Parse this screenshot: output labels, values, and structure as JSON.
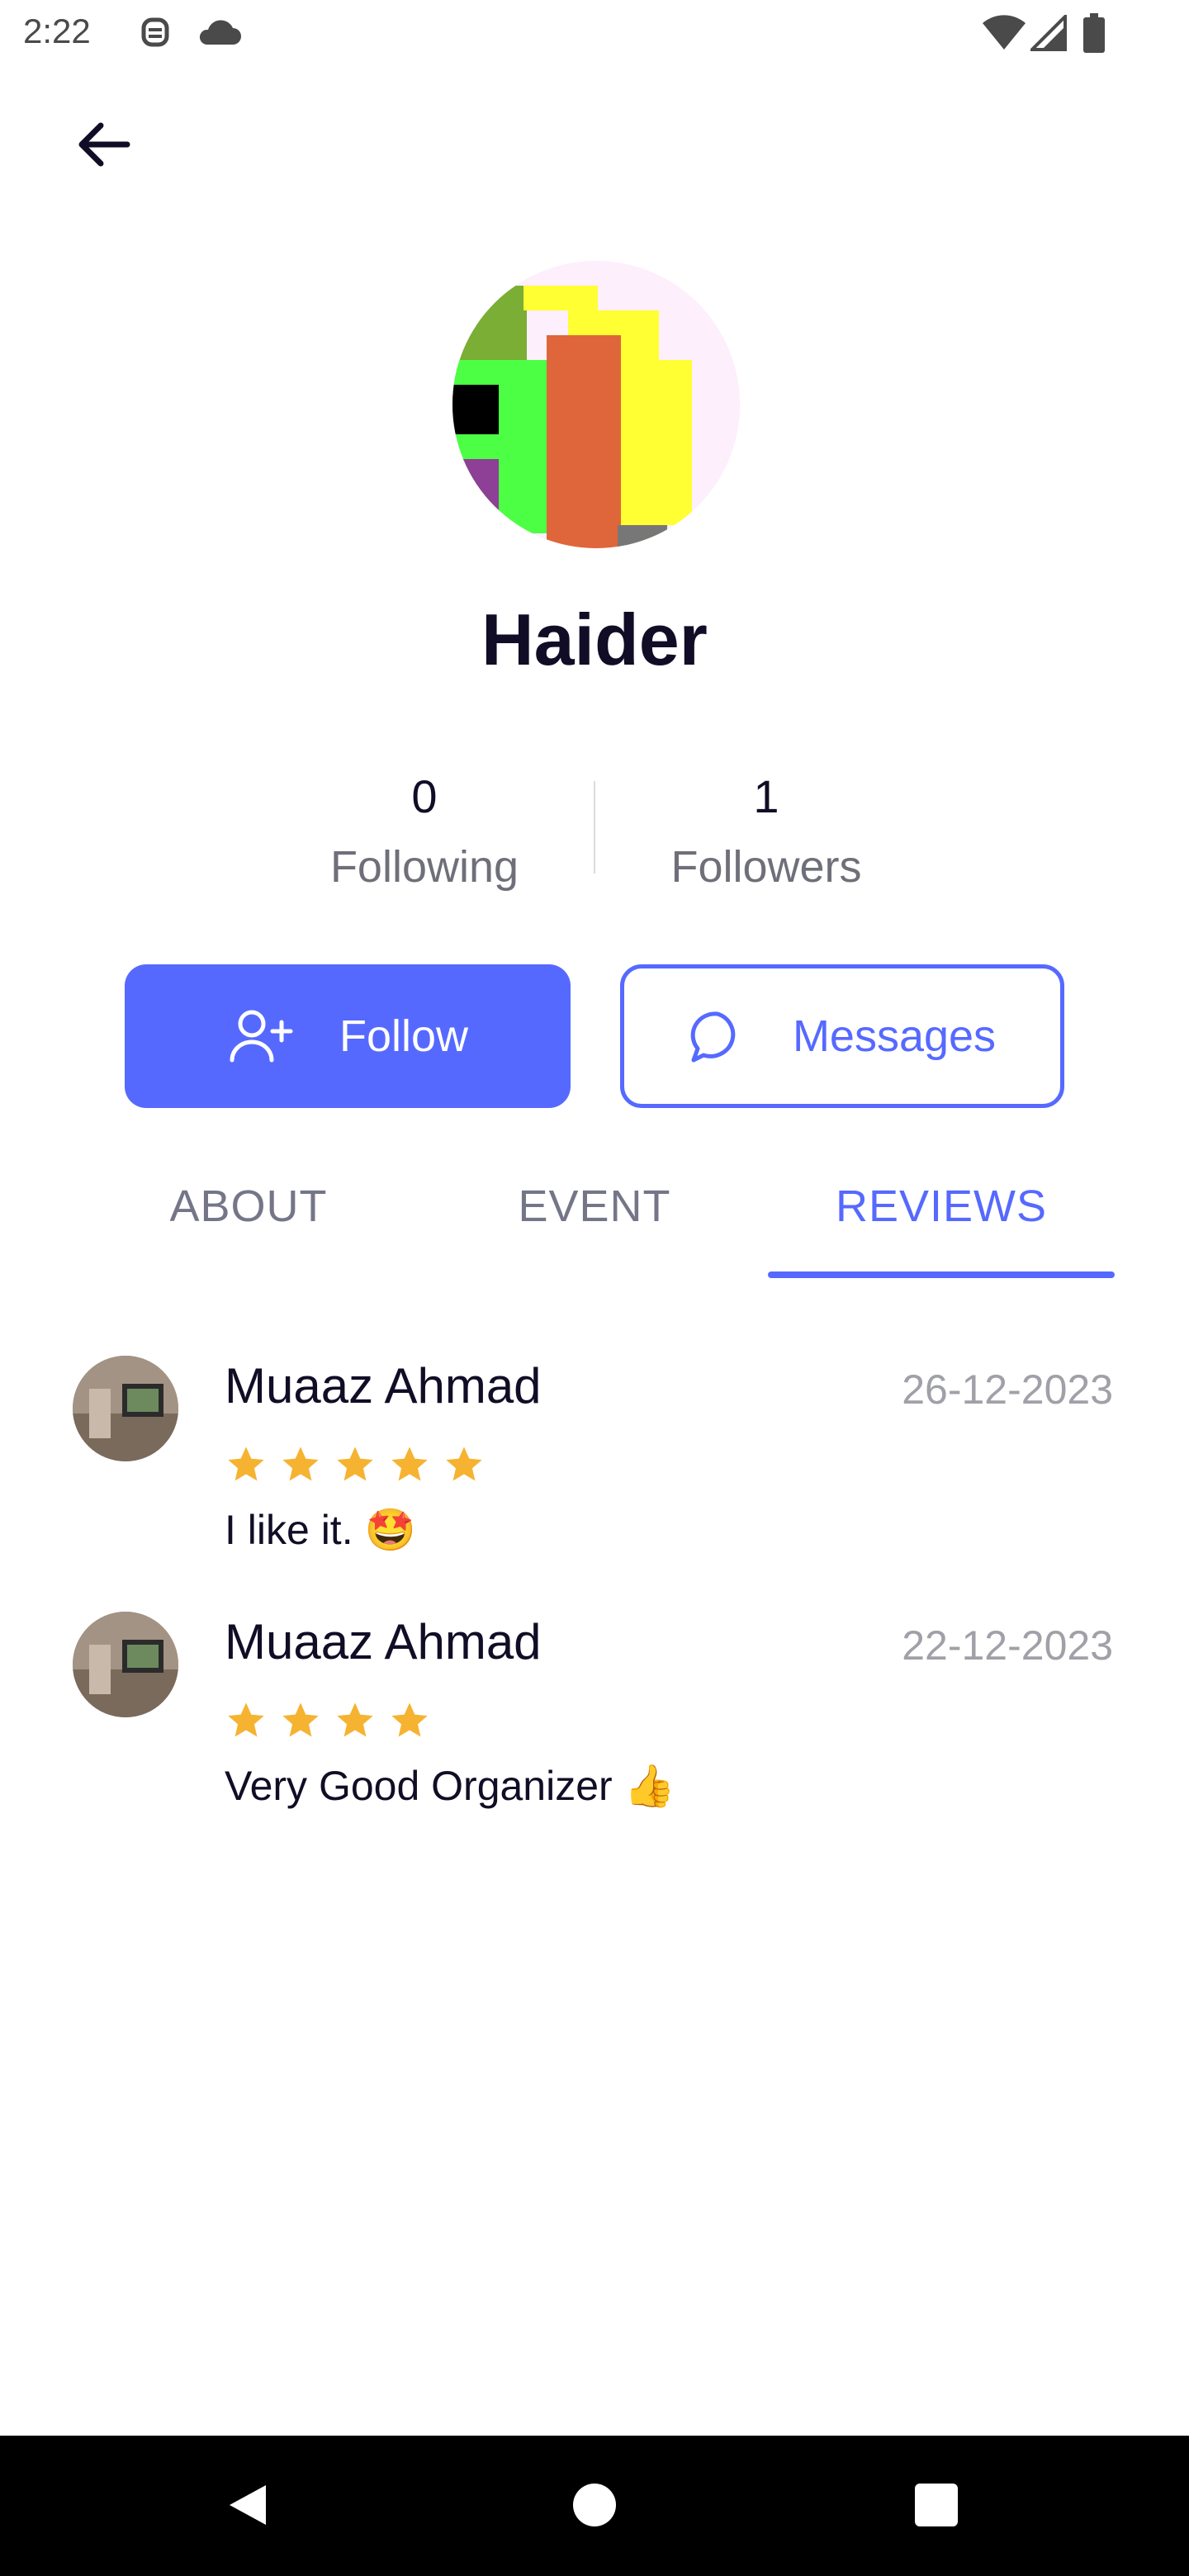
{
  "status_bar": {
    "time": "2:22"
  },
  "profile": {
    "name": "Haider",
    "following_count": "0",
    "following_label": "Following",
    "followers_count": "1",
    "followers_label": "Followers"
  },
  "actions": {
    "follow_label": "Follow",
    "messages_label": "Messages"
  },
  "tabs": [
    {
      "label": "ABOUT",
      "active": false
    },
    {
      "label": "EVENT",
      "active": false
    },
    {
      "label": "REVIEWS",
      "active": true
    }
  ],
  "reviews": [
    {
      "author": "Muaaz Ahmad",
      "date": "26-12-2023",
      "rating": 5,
      "text": "I like it. 🤩"
    },
    {
      "author": "Muaaz Ahmad",
      "date": "22-12-2023",
      "rating": 4,
      "text": "Very Good Organizer 👍"
    }
  ],
  "colors": {
    "accent": "#5669ff",
    "star": "#f6b331"
  }
}
